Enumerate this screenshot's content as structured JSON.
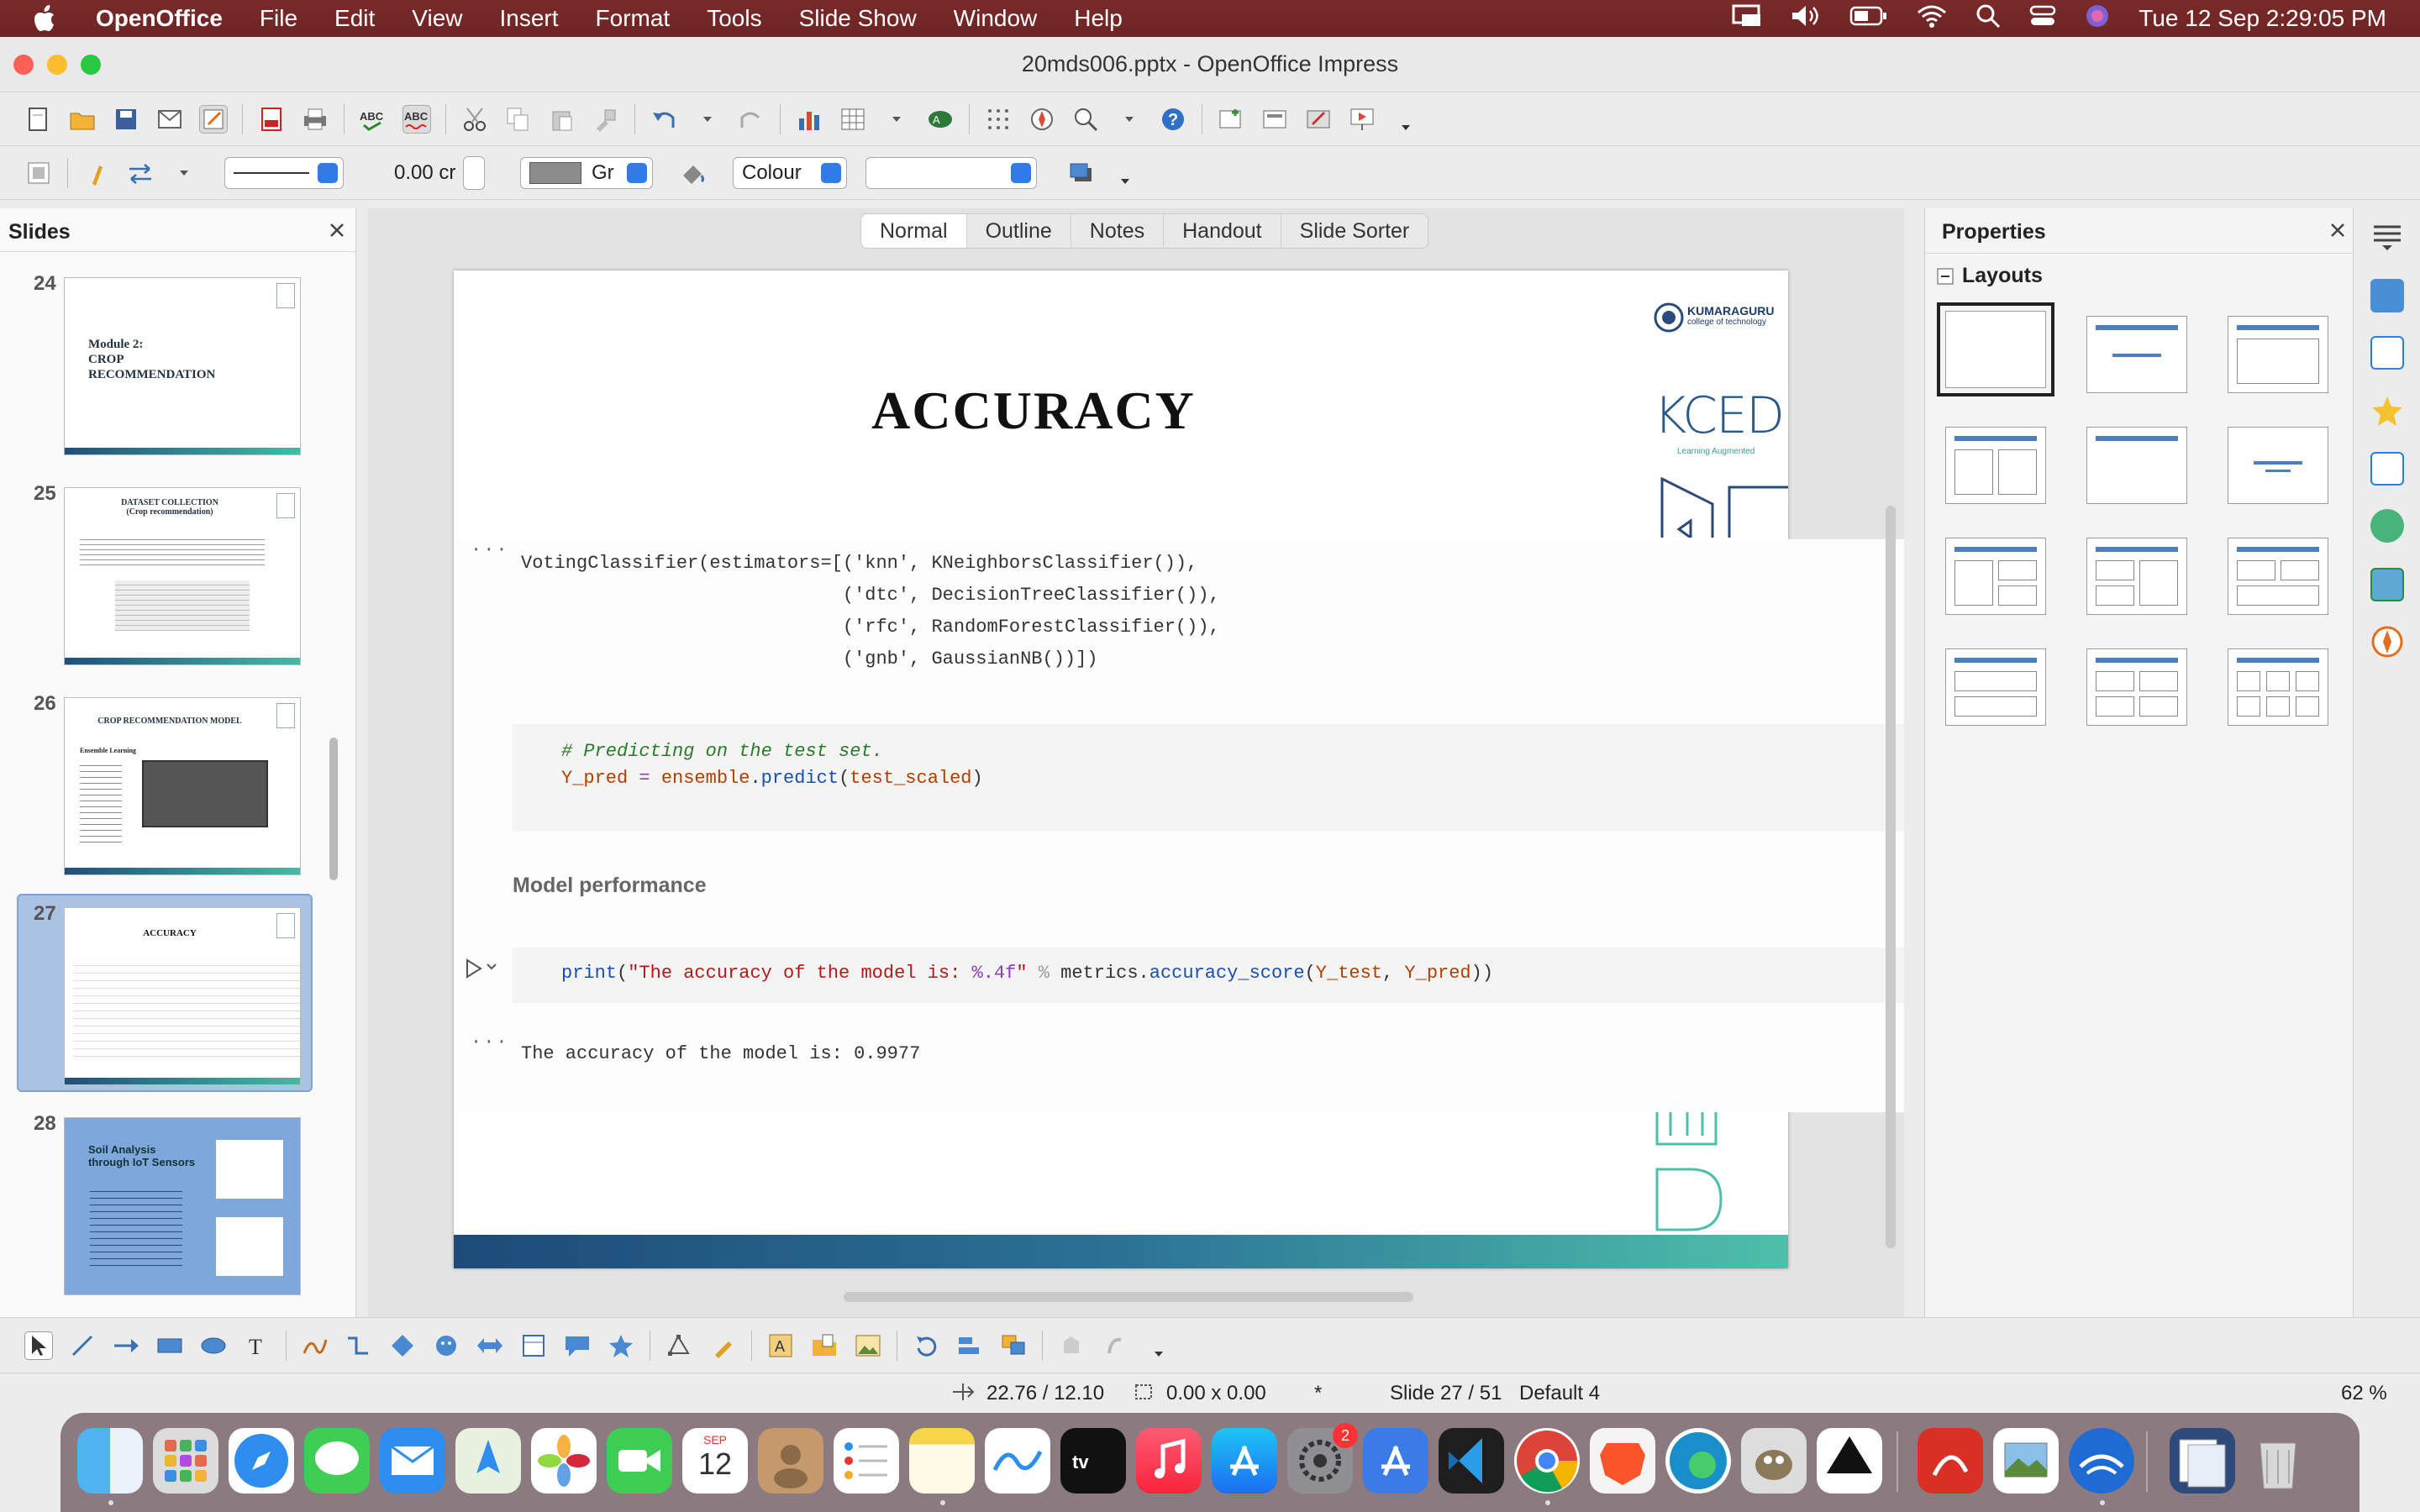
{
  "menubar": {
    "app_name": "OpenOffice",
    "items": [
      "File",
      "Edit",
      "View",
      "Insert",
      "Format",
      "Tools",
      "Slide Show",
      "Window",
      "Help"
    ],
    "clock": "Tue 12 Sep  2:29:05 PM"
  },
  "window": {
    "title": "20mds006.pptx - OpenOffice Impress"
  },
  "line_toolbar": {
    "width_value": "0.00 cr",
    "fill_color_label": "Gr",
    "area_style": "Colour",
    "area_color": ""
  },
  "slides_pane": {
    "title": "Slides",
    "thumbnails": [
      {
        "number": "24",
        "lines": [
          "Module 2:",
          "CROP",
          "RECOMMENDATION"
        ]
      },
      {
        "number": "25",
        "title": "DATASET COLLECTION",
        "subtitle": "(Crop recommendation)"
      },
      {
        "number": "26",
        "title": "CROP RECOMMENDATION MODEL",
        "caption": "Ensemble Learning"
      },
      {
        "number": "27",
        "title": "ACCURACY"
      },
      {
        "number": "28",
        "title": "Soil Analysis through IoT Sensors"
      }
    ]
  },
  "view_tabs": [
    "Normal",
    "Outline",
    "Notes",
    "Handout",
    "Slide Sorter"
  ],
  "slide": {
    "title": "ACCURACY",
    "logo_org": "KUMARAGURU",
    "logo_sub": "college of technology",
    "logo_brand": "KCED",
    "logo_tagline": "Learning Augmented",
    "notebook": {
      "ellipsis": "···",
      "code1": [
        "VotingClassifier(estimators=[('knn', KNeighborsClassifier()),",
        "                             ('dtc', DecisionTreeClassifier()),",
        "                             ('rfc', RandomForestClassifier()),",
        "                             ('gnb', GaussianNB())])"
      ],
      "comment": "# Predicting on the test set.",
      "pred_var": "Y_pred",
      "pred_eq": " = ",
      "pred_obj": "ensemble",
      "pred_dot": ".",
      "pred_fn": "predict",
      "pred_open": "(",
      "pred_arg": "test_scaled",
      "pred_close": ")",
      "heading": "Model performance",
      "print_fn": "print",
      "print_open": "(",
      "print_str": "\"The accuracy of the model is: ",
      "print_fmt": "%.4f",
      "print_str_end": "\"",
      "print_op": " % ",
      "print_mod": "metrics.",
      "print_call": "accuracy_score",
      "print_args_open": "(",
      "print_arg1": "Y_test",
      "print_comma": ", ",
      "print_arg2": "Y_pred",
      "print_close": "))",
      "output": "The accuracy of the model is: 0.9977"
    }
  },
  "properties": {
    "title": "Properties",
    "section": "Layouts"
  },
  "statusbar": {
    "position": "22.76 / 12.10",
    "size": "0.00 x 0.00",
    "modified": "*",
    "slide": "Slide 27 / 51",
    "master": "Default 4",
    "zoom": "62 %"
  },
  "dock": {
    "calendar_month": "SEP",
    "calendar_day": "12",
    "settings_badge": "2"
  },
  "colors": {
    "menubar": "#6e2424",
    "accent": "#2f7be8",
    "slide_bar_start": "#1d4a78",
    "slide_bar_end": "#4ebfaa"
  }
}
